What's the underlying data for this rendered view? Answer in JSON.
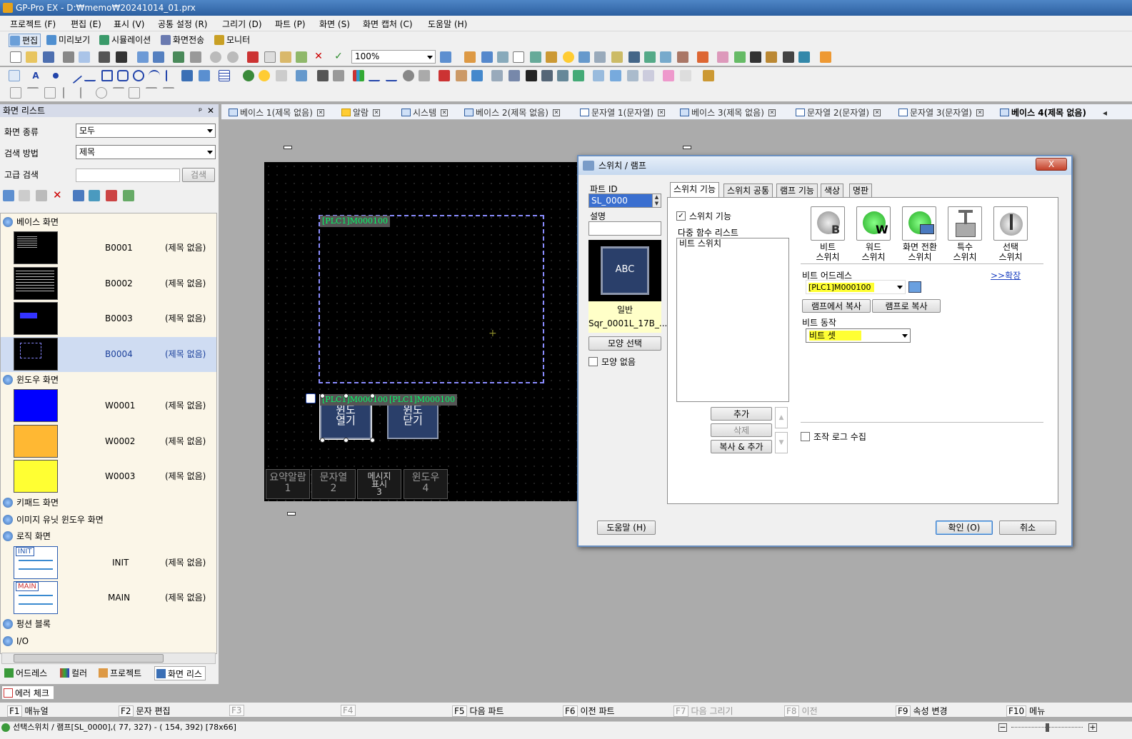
{
  "window": {
    "title": "GP-Pro EX - D:₩memo₩20241014_01.prx"
  },
  "menu": [
    "프로젝트 (F)",
    "편집 (E)",
    "표시 (V)",
    "공통 설정 (R)",
    "그리기 (D)",
    "파트 (P)",
    "화면 (S)",
    "화면 캡처 (C)",
    "도움말 (H)"
  ],
  "toolbar1": {
    "edit": "편집",
    "preview": "미리보기",
    "sim": "시뮬레이션",
    "transfer": "화면전송",
    "monitor": "모니터"
  },
  "toolbar2": {
    "zoom": "100%"
  },
  "screen_list": {
    "title": "화면 리스트",
    "type_label": "화면 종류",
    "type_value": "모두",
    "search_label": "검색 방법",
    "search_value": "제목",
    "adv_label": "고급 검색",
    "search_button": "검색",
    "categories": {
      "base": "베이스 화면",
      "window": "윈도우 화면",
      "keypad": "키패드 화면",
      "image": "이미지 유닛 윈도우 화면",
      "logic": "로직 화면",
      "function": "펑션 블록",
      "io": "I/O"
    },
    "base": [
      {
        "id": "B0001",
        "title": "(제목 없음)"
      },
      {
        "id": "B0002",
        "title": "(제목 없음)"
      },
      {
        "id": "B0003",
        "title": "(제목 없음)"
      },
      {
        "id": "B0004",
        "title": "(제목 없음)"
      }
    ],
    "windows": [
      {
        "id": "W0001",
        "title": "(제목 없음)"
      },
      {
        "id": "W0002",
        "title": "(제목 없음)"
      },
      {
        "id": "W0003",
        "title": "(제목 없음)"
      }
    ],
    "logic": [
      {
        "id": "INIT",
        "title": "(제목 없음)",
        "thumb": "INIT"
      },
      {
        "id": "MAIN",
        "title": "(제목 없음)",
        "thumb": "MAIN"
      }
    ]
  },
  "bottom_tabs": [
    "어드레스",
    "컬러",
    "프로젝트",
    "화면 리스"
  ],
  "error_check": "에러 체크",
  "doc_tabs": [
    "베이스 1(제목 없음)",
    "알람",
    "시스템",
    "베이스 2(제목 없음)",
    "문자열 1(문자열)",
    "베이스 3(제목 없음)",
    "문자열 2(문자열)",
    "문자열 3(문자열)",
    "베이스 4(제목 없음)"
  ],
  "canvas": {
    "frame_label": "[PLC1]M000100",
    "sw1_label": "[PLC1]M000100",
    "sw2_label": "[PLC1]M000100",
    "sw1_l1": "윈도",
    "sw1_l2": "열기",
    "sw2_l1": "윈도",
    "sw2_l2": "닫기",
    "tabs": [
      {
        "l1": "요약알람",
        "l2": "1"
      },
      {
        "l1": "문자열",
        "l2": "2"
      },
      {
        "l1": "메시지\n표시",
        "l2": "3"
      },
      {
        "l1": "윈도우",
        "l2": "4"
      }
    ]
  },
  "dialog": {
    "title": "스위치 / 램프",
    "close": "X",
    "part_id_label": "파트 ID",
    "part_id": "SL_0000",
    "desc_label": "설명",
    "preview_text": "ABC",
    "preview_kind": "일반",
    "preview_name": "Sqr_0001L_17B_...",
    "shape_button": "모양 선택",
    "no_shape": "모양 없음",
    "tabs": [
      "스위치 기능",
      "스위치 공통",
      "램프 기능",
      "색상",
      "명판"
    ],
    "switch_func_check": "스위치 기능",
    "multi_list_label": "다중 함수 리스트",
    "list_items": [
      "비트 스위치"
    ],
    "add": "추가",
    "delete": "삭제",
    "copy_add": "복사 & 추가",
    "types": [
      {
        "l1": "비트",
        "l2": "스위치",
        "icon": "bit-switch-icon"
      },
      {
        "l1": "워드",
        "l2": "스위치",
        "icon": "word-switch-icon"
      },
      {
        "l1": "화면 전환",
        "l2": "스위치",
        "icon": "screen-change-switch-icon"
      },
      {
        "l1": "특수",
        "l2": "스위치",
        "icon": "special-switch-icon"
      },
      {
        "l1": "선택",
        "l2": "스위치",
        "icon": "selector-switch-icon"
      }
    ],
    "bit_addr_label": "비트 어드레스",
    "expand": ">>확장",
    "bit_addr": "[PLC1]M000100",
    "copy_from_lamp": "램프에서 복사",
    "copy_to_lamp": "램프로 복사",
    "bit_action_label": "비트 동작",
    "bit_action": "비트 셋",
    "log_check": "조작 로그 수집",
    "help": "도움말 (H)",
    "ok": "확인 (O)",
    "cancel": "취소"
  },
  "fkeys": [
    {
      "k": "F1",
      "t": "매뉴얼",
      "on": true
    },
    {
      "k": "F2",
      "t": "문자 편집",
      "on": true
    },
    {
      "k": "F3",
      "t": "",
      "on": false
    },
    {
      "k": "F4",
      "t": "",
      "on": false
    },
    {
      "k": "F5",
      "t": "다음 파트",
      "on": true
    },
    {
      "k": "F6",
      "t": "이전 파트",
      "on": true
    },
    {
      "k": "F7",
      "t": "다음 그리기",
      "on": false
    },
    {
      "k": "F8",
      "t": "이전",
      "on": false
    },
    {
      "k": "F9",
      "t": "속성 변경",
      "on": true
    },
    {
      "k": "F10",
      "t": "메뉴",
      "on": true
    }
  ],
  "status": "선택스위치 / 램프[SL_0000],( 77, 327) - ( 154, 392) [78x66]"
}
